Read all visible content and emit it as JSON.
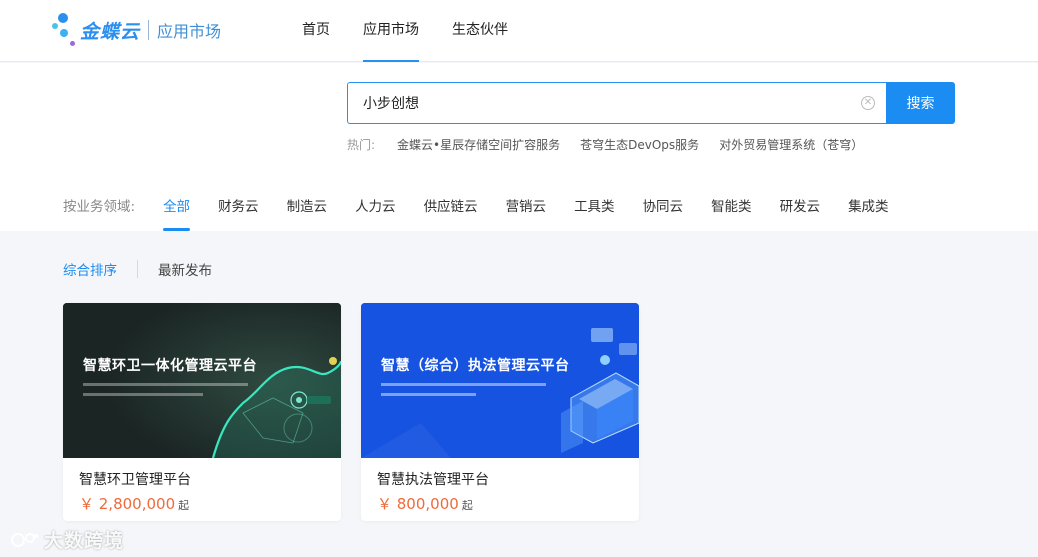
{
  "brand": {
    "logo_text": "金蝶云",
    "sub_text": "应用市场",
    "colors": {
      "primary": "#1a8cf2",
      "price": "#f06a3a"
    }
  },
  "nav": {
    "items": [
      {
        "label": "首页",
        "active": false
      },
      {
        "label": "应用市场",
        "active": true
      },
      {
        "label": "生态伙伴",
        "active": false
      }
    ]
  },
  "search": {
    "value": "小步创想",
    "button_label": "搜索",
    "hot_label": "热门:",
    "hot_items": [
      "金蝶云•星辰存储空间扩容服务",
      "苍穹生态DevOps服务",
      "对外贸易管理系统（苍穹）"
    ]
  },
  "categories": {
    "label": "按业务领域:",
    "items": [
      {
        "label": "全部",
        "active": true
      },
      {
        "label": "财务云"
      },
      {
        "label": "制造云"
      },
      {
        "label": "人力云"
      },
      {
        "label": "供应链云"
      },
      {
        "label": "营销云"
      },
      {
        "label": "工具类"
      },
      {
        "label": "协同云"
      },
      {
        "label": "智能类"
      },
      {
        "label": "研发云"
      },
      {
        "label": "集成类"
      }
    ]
  },
  "sort": {
    "items": [
      {
        "label": "综合排序",
        "active": true
      },
      {
        "label": "最新发布"
      }
    ]
  },
  "products": [
    {
      "image_title": "智慧环卫一体化管理云平台",
      "name": "智慧环卫管理平台",
      "price": "￥ 2,800,000",
      "price_unit": "起"
    },
    {
      "image_title": "智慧（综合）执法管理云平台",
      "name": "智慧执法管理平台",
      "price": "￥ 800,000",
      "price_unit": "起"
    }
  ],
  "watermark": "大数跨境"
}
